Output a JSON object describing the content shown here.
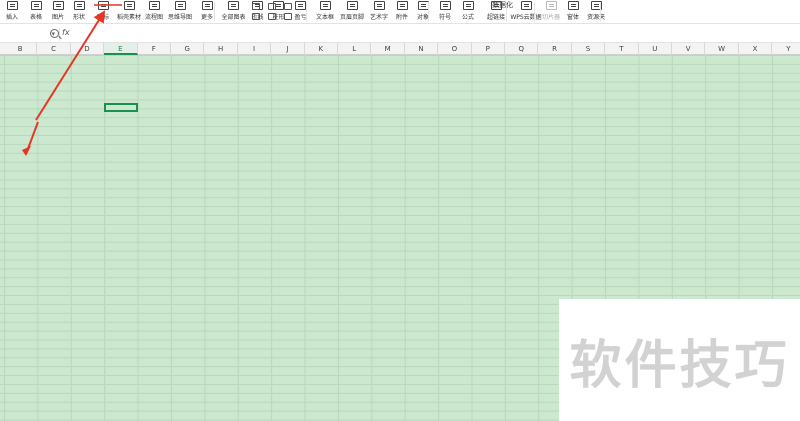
{
  "ribbon": {
    "items": [
      {
        "label": "插入",
        "icon": "table-icon",
        "enabled": true
      },
      {
        "label": "表格",
        "icon": "table-icon",
        "enabled": true
      },
      {
        "label": "图片",
        "icon": "picture-icon",
        "enabled": true
      },
      {
        "label": "形状",
        "icon": "shape-icon",
        "enabled": true
      },
      {
        "label": "图标",
        "icon": "icon-library-icon",
        "enabled": true
      },
      {
        "label": "稻壳素材",
        "icon": "material-icon",
        "enabled": true
      },
      {
        "label": "流程图",
        "icon": "flowchart-icon",
        "enabled": true
      },
      {
        "label": "思维导图",
        "icon": "mindmap-icon",
        "enabled": true
      },
      {
        "label": "更多",
        "icon": "more-icon",
        "enabled": true
      },
      {
        "label": "全部图表",
        "icon": "chart-icon",
        "enabled": true
      },
      {
        "label": "折线",
        "icon": "line-chart-icon",
        "enabled": true
      },
      {
        "label": "柱形",
        "icon": "column-chart-icon",
        "enabled": true
      },
      {
        "label": "盈亏",
        "icon": "winloss-icon",
        "enabled": true
      },
      {
        "label": "文本框",
        "icon": "textbox-icon",
        "enabled": true
      },
      {
        "label": "页眉页脚",
        "icon": "header-footer-icon",
        "enabled": true
      },
      {
        "label": "艺术字",
        "icon": "wordart-icon",
        "enabled": true
      },
      {
        "label": "附件",
        "icon": "attachment-icon",
        "enabled": true
      },
      {
        "label": "对象",
        "icon": "object-icon",
        "enabled": true
      },
      {
        "label": "符号",
        "icon": "omega-icon",
        "enabled": true
      },
      {
        "label": "公式",
        "icon": "formula-icon",
        "enabled": true
      },
      {
        "label": "超链接",
        "icon": "hyperlink-icon",
        "enabled": true
      },
      {
        "label": "WPS云数据",
        "icon": "cloud-data-icon",
        "enabled": true
      },
      {
        "label": "切片器",
        "icon": "slicer-icon",
        "enabled": false
      },
      {
        "label": "窗体",
        "icon": "form-icon",
        "enabled": true
      },
      {
        "label": "资源夹",
        "icon": "resource-icon",
        "enabled": true
      }
    ],
    "mini_label": "数据化"
  },
  "formula_bar": {
    "name_box_value": "",
    "fx_label": "fx",
    "formula_value": ""
  },
  "grid": {
    "columns": [
      "B",
      "C",
      "D",
      "E",
      "F",
      "G",
      "H",
      "I",
      "J",
      "K",
      "L",
      "M",
      "N",
      "O",
      "P",
      "Q",
      "R",
      "S",
      "T",
      "U",
      "V",
      "W",
      "X",
      "Y"
    ],
    "active_column": "E",
    "sheet_color": "#cce8cf",
    "active_color": "#1a8f4e"
  },
  "annotation": {
    "arrow_color": "#e53525"
  },
  "watermark": {
    "text": "软件技巧"
  }
}
